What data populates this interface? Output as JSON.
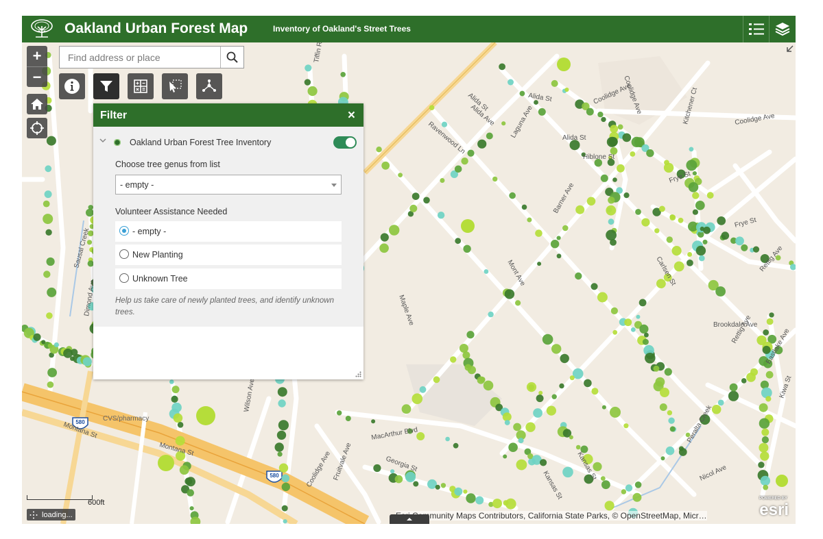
{
  "header": {
    "title": "Oakland Urban Forest Map",
    "subtitle": "Inventory of Oakland's Street Trees"
  },
  "search": {
    "placeholder": "Find address or place"
  },
  "zoom": {
    "in": "+",
    "out": "−"
  },
  "filter": {
    "title": "Filter",
    "close": "×",
    "layer_name": "Oakland Urban Forest Tree Inventory",
    "genus_label": "Choose tree genus from list",
    "genus_value": "- empty -",
    "volunteer_label": "Volunteer Assistance Needed",
    "options": [
      "- empty -",
      "New Planting",
      "Unknown Tree"
    ],
    "selected_option": "- empty -",
    "help_text": "Help us take care of newly planted trees, and identify unknown trees."
  },
  "map_labels": {
    "streets": [
      "Alida St",
      "Alida St",
      "Alida St",
      "Coolidge Ave",
      "Coolidge Ave",
      "Coolidge Ave",
      "Ravenwood Ln",
      "Kitchener Ct",
      "Frye St",
      "Frye St",
      "Barner Ave",
      "Carlsen St",
      "Rettig Ave",
      "Rettig Ave",
      "Montana St",
      "Montana St",
      "MacArthur Blvd",
      "Kansas St",
      "Eastlake Ave",
      "Nicol Ave",
      "Dimond Ave",
      "Wilson Ave",
      "Laguna Ave",
      "Maple Ave",
      "Mont Ave",
      "Georgia St",
      "Fruitvale Ave",
      "Coolidge Ave",
      "Peralta Creek",
      "Sausal Creek",
      "Tiffin Rd",
      "Alida Ave",
      "Hiblone St",
      "Brookdale Ave",
      "Kiwa St",
      "Kansas St"
    ],
    "places": [
      "CVS/pharmacy"
    ],
    "shields": [
      "580",
      "580"
    ]
  },
  "scale": {
    "label": "600ft"
  },
  "status": {
    "loading": "loading..."
  },
  "attribution": "Esri Community Maps Contributors, California State Parks, © OpenStreetMap, Micr…",
  "esri": {
    "powered": "POWERED BY",
    "brand": "esri"
  },
  "colors": {
    "brand_green": "#2e6f2a",
    "map_bg": "#f2ece2",
    "tree_colors": [
      "#3b7a2c",
      "#5aa33a",
      "#8dc63f",
      "#b5dd3a",
      "#6fd3c3"
    ]
  }
}
